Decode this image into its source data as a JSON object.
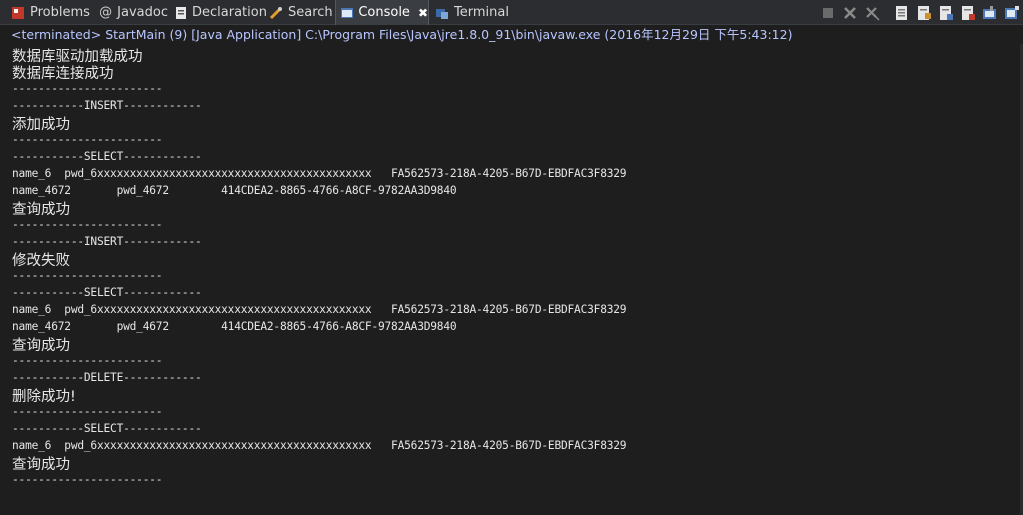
{
  "tabs": [
    {
      "label": "Problems",
      "icon": "problems-icon"
    },
    {
      "label": "Javadoc",
      "icon": "javadoc-icon"
    },
    {
      "label": "Declaration",
      "icon": "declaration-icon"
    },
    {
      "label": "Search",
      "icon": "search-icon"
    },
    {
      "label": "Console",
      "icon": "console-icon",
      "active": true,
      "close": "✖"
    },
    {
      "label": "Terminal",
      "icon": "terminal-icon"
    }
  ],
  "status_line": "<terminated> StartMain (9) [Java Application] C:\\Program Files\\Java\\jre1.8.0_91\\bin\\javaw.exe (2016年12月29日 下午5:43:12)",
  "console_lines": [
    "数据库驱动加载成功",
    "数据库连接成功",
    "-----------------------",
    "-----------INSERT------------",
    "添加成功",
    "-----------------------",
    "-----------SELECT------------",
    "name_6  pwd_6xxxxxxxxxxxxxxxxxxxxxxxxxxxxxxxxxxxxxxxxxx   FA562573-218A-4205-B67D-EBDFAC3F8329",
    "name_4672       pwd_4672        414CDEA2-8865-4766-A8CF-9782AA3D9840",
    "查询成功",
    "-----------------------",
    "-----------INSERT------------",
    "修改失败",
    "-----------------------",
    "-----------SELECT------------",
    "name_6  pwd_6xxxxxxxxxxxxxxxxxxxxxxxxxxxxxxxxxxxxxxxxxx   FA562573-218A-4205-B67D-EBDFAC3F8329",
    "name_4672       pwd_4672        414CDEA2-8865-4766-A8CF-9782AA3D9840",
    "查询成功",
    "-----------------------",
    "-----------DELETE------------",
    "删除成功!",
    "-----------------------",
    "-----------SELECT------------",
    "name_6  pwd_6xxxxxxxxxxxxxxxxxxxxxxxxxxxxxxxxxxxxxxxxxx   FA562573-218A-4205-B67D-EBDFAC3F8329",
    "查询成功",
    "-----------------------"
  ],
  "colors": {
    "background": "#1e1e1e",
    "status_text": "#b8c6ff",
    "console_text": "#e6e6e6"
  }
}
